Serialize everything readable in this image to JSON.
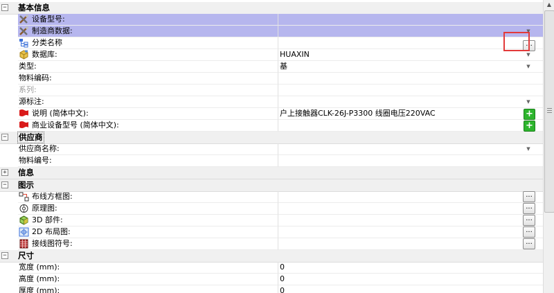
{
  "sections": {
    "basic": {
      "title": "基本信息",
      "toggle": "−",
      "device_model": "设备型号:",
      "manufacturer_data": "制造商数据:",
      "category_name": "分类名称",
      "database": "数据库:",
      "database_value": "HUAXIN",
      "type": "类型:",
      "type_value": "基",
      "material_code": "物料编码:",
      "series": "系列:",
      "source_note": "源标注:",
      "description": "说明 (简体中文):",
      "description_value": "户上接触器CLK-26J-P3300  线圈电压220VAC",
      "commercial_model": "商业设备型号 (简体中文):"
    },
    "supplier": {
      "title": "供应商",
      "toggle": "−",
      "supplier_name": "供应商名称:",
      "material_number": "物料编号:"
    },
    "info": {
      "title": "信息",
      "toggle": "+"
    },
    "symbols": {
      "title": "图示",
      "toggle": "−",
      "wiring_block": "布线方框图:",
      "schematic": "原理图:",
      "part_3d": "3D 部件:",
      "layout_2d": "2D 布局图:",
      "terminal_symbol": "接线图符号:"
    },
    "dimensions": {
      "title": "尺寸",
      "toggle": "−",
      "width": "宽度 (mm):",
      "width_value": "0",
      "height": "高度 (mm):",
      "height_value": "0",
      "depth": "厚度 (mm):",
      "depth_value": "0"
    }
  },
  "buttons": {
    "ellipsis": "...",
    "plus": "+",
    "dropdown": "▼"
  },
  "scrollbar": {
    "up": "▲"
  },
  "colors": {
    "selected_row": "#b6b6ee",
    "highlight": "#e23a3a",
    "add_button": "#2db52d"
  }
}
